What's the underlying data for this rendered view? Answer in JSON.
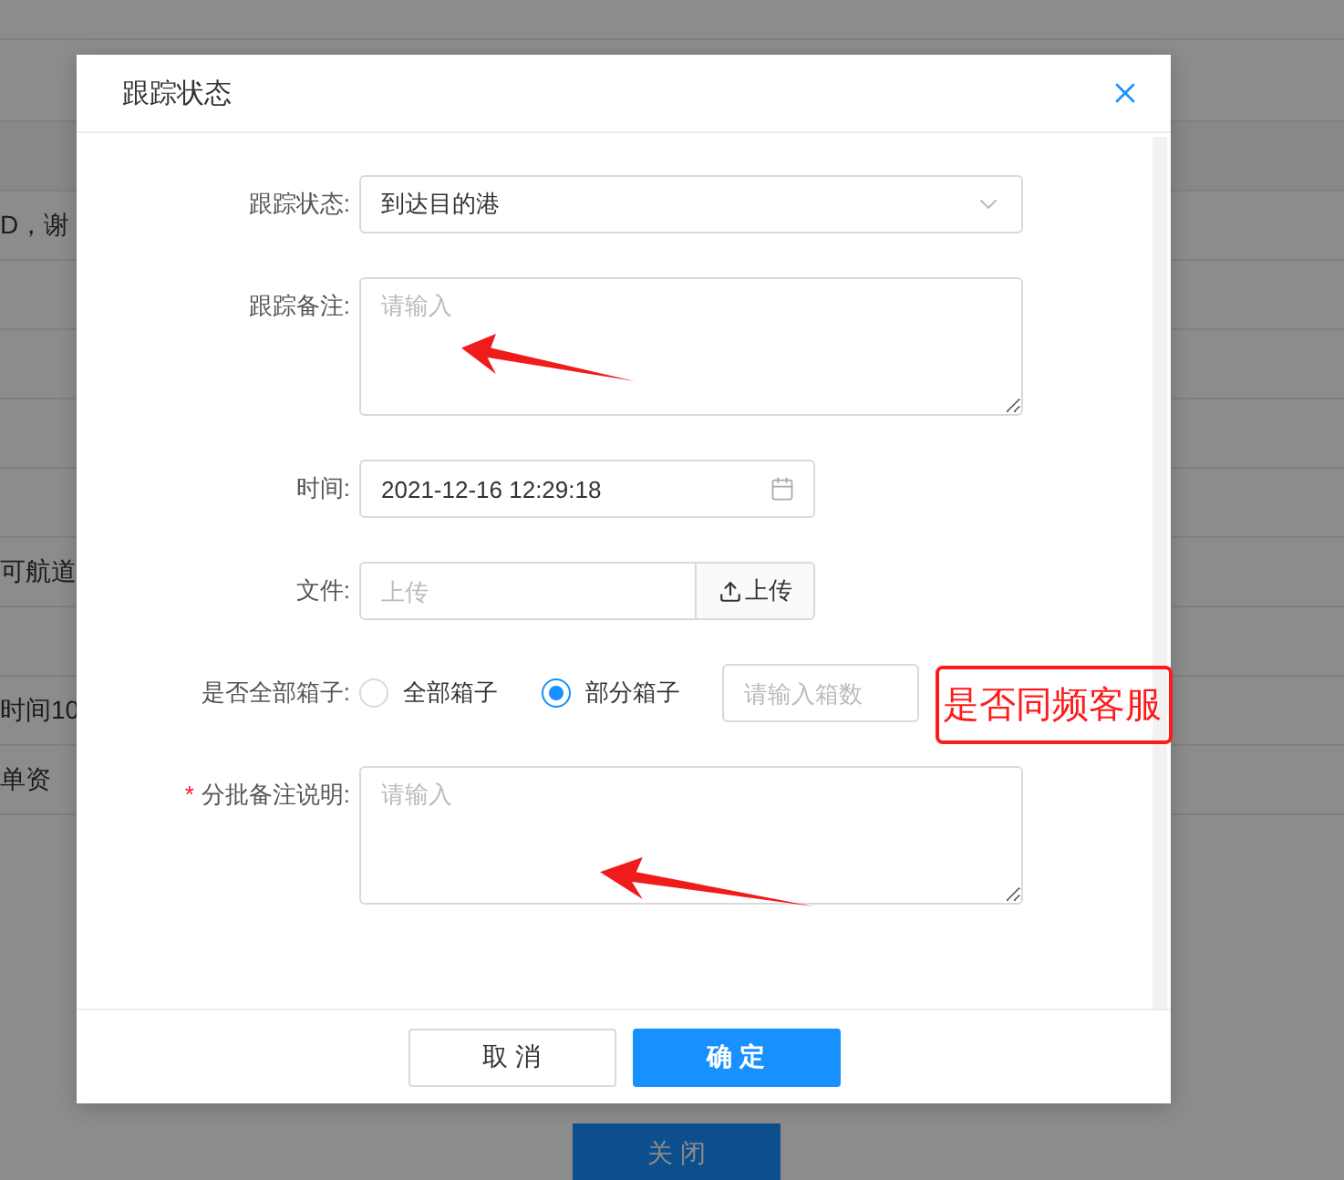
{
  "background": {
    "rows": [
      {
        "text": "D，谢"
      },
      {},
      {},
      {},
      {},
      {
        "text": "可航道"
      },
      {},
      {
        "text": "时间10"
      },
      {
        "text": "单资"
      }
    ],
    "close_button": "关 闭"
  },
  "dialog": {
    "title": "跟踪状态",
    "fields": [
      {
        "kind": "select",
        "label": "跟踪状态:",
        "value": "到达目的港"
      },
      {
        "kind": "textarea",
        "label": "跟踪备注:",
        "placeholder": "请输入"
      },
      {
        "kind": "date",
        "label": "时间:",
        "value": "2021-12-16 12:29:18"
      },
      {
        "kind": "upload",
        "label": "文件:",
        "placeholder": "上传",
        "button": "上传"
      },
      {
        "kind": "radio",
        "label": "是否全部箱子:",
        "options": [
          {
            "label": "全部箱子",
            "selected": false
          },
          {
            "label": "部分箱子",
            "selected": true
          }
        ],
        "placeholder": "请输入箱数"
      },
      {
        "kind": "textarea",
        "label": "分批备注说明:",
        "placeholder": "请输入",
        "required_mark": "*"
      }
    ],
    "buttons": [
      {
        "label": "取 消",
        "kind": "default"
      },
      {
        "label": "确 定",
        "kind": "primary"
      }
    ]
  },
  "annotation": {
    "text": "是否同频客服"
  }
}
